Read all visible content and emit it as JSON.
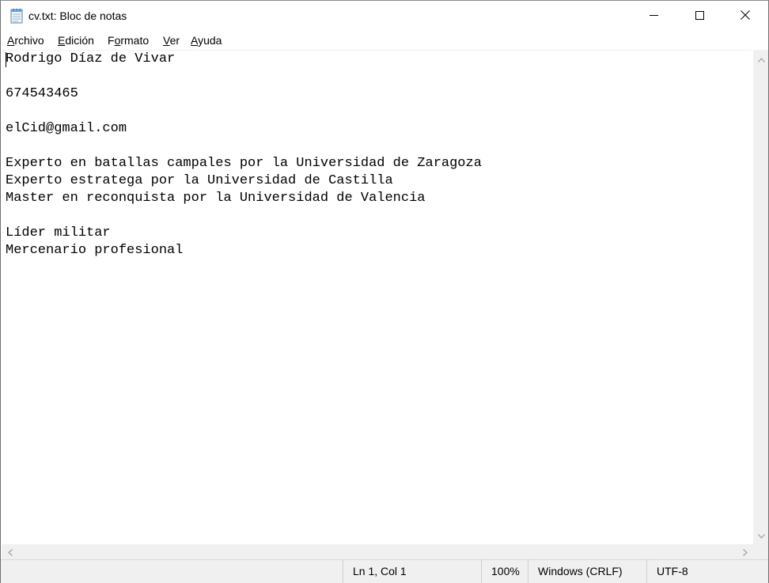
{
  "window": {
    "title": "cv.txt: Bloc de notas",
    "icon": "notepad-icon",
    "controls": {
      "minimize_icon": "minimize-icon",
      "maximize_icon": "maximize-icon",
      "close_icon": "close-icon"
    }
  },
  "menu": [
    {
      "pre": "",
      "acc": "A",
      "post": "rchivo"
    },
    {
      "pre": "",
      "acc": "E",
      "post": "dición"
    },
    {
      "pre": "F",
      "acc": "o",
      "post": "rmato"
    },
    {
      "pre": "",
      "acc": "V",
      "post": "er"
    },
    {
      "pre": "",
      "acc": "A",
      "post": "yuda"
    }
  ],
  "document": {
    "lines": [
      "Rodrigo Díaz de Vivar",
      "",
      "674543465",
      "",
      "elCid@gmail.com",
      "",
      "Experto en batallas campales por la Universidad de Zaragoza",
      "Experto estratega por la Universidad de Castilla",
      "Master en reconquista por la Universidad de Valencia",
      "",
      "Líder militar",
      "Mercenario profesional"
    ]
  },
  "status": {
    "position": "Ln 1, Col 1",
    "zoom": "100%",
    "line_endings": "Windows (CRLF)",
    "encoding": "UTF-8"
  },
  "colors": {
    "chrome_bg": "#f0f0f0",
    "editor_bg": "#ffffff",
    "text": "#000000"
  }
}
